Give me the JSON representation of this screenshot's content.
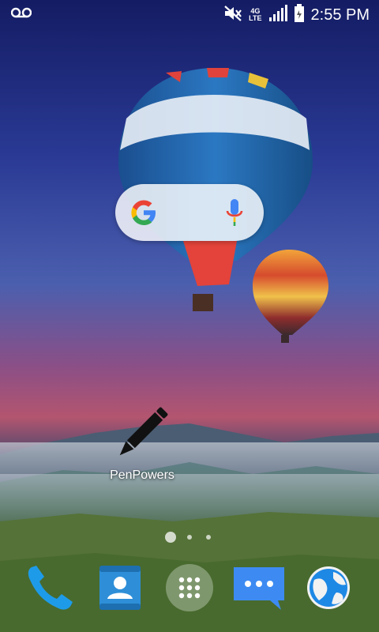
{
  "status_bar": {
    "time": "2:55 PM",
    "network_top": "4G",
    "network_bottom": "LTE",
    "icons": [
      "voicemail-icon",
      "volume-muted-icon",
      "network-4g-lte-icon",
      "signal-strength-icon",
      "battery-icon"
    ]
  },
  "search_widget": {
    "logo": "google-g-logo",
    "mic": "mic-icon"
  },
  "home_apps": [
    {
      "label": "PenPowers",
      "icon": "pen-icon"
    }
  ],
  "page_indicator": {
    "pages": 3,
    "current": 1
  },
  "dock": [
    {
      "icon": "phone-icon",
      "color": "#1E9BE8"
    },
    {
      "icon": "contacts-icon",
      "color": "#2E8FD8"
    },
    {
      "icon": "app-drawer-icon",
      "color": "#FFFFFF"
    },
    {
      "icon": "messages-icon",
      "color": "#3D8BF2"
    },
    {
      "icon": "browser-globe-icon",
      "color": "#1E88E5"
    }
  ]
}
